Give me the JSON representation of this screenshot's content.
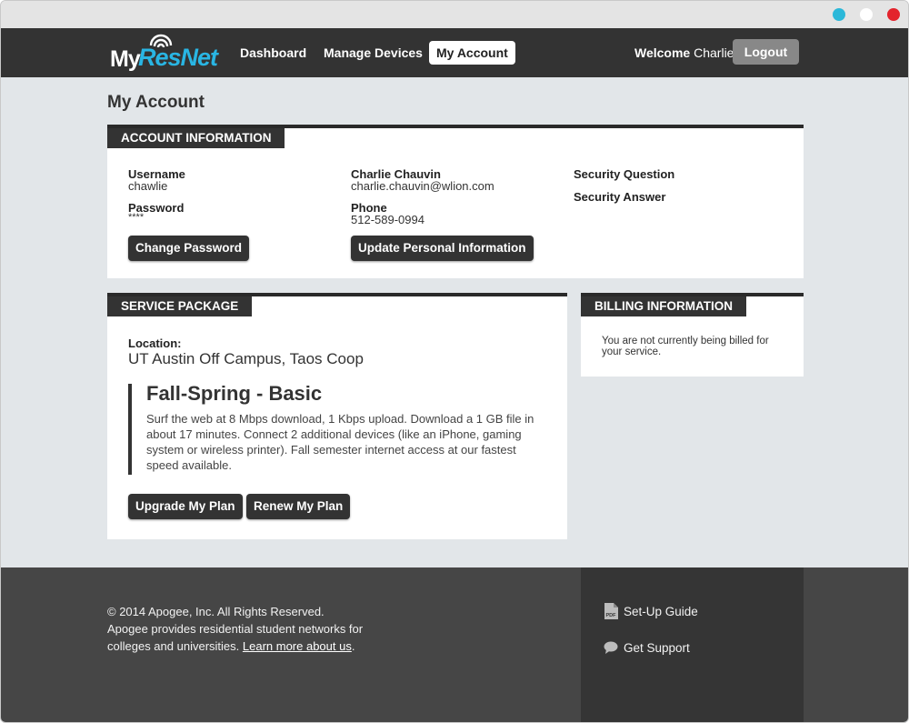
{
  "window": {
    "controls": [
      "blue-dot",
      "white-dot",
      "red-dot"
    ],
    "colors": {
      "blue": "#2bb8d9",
      "white": "#ffffff",
      "red": "#e3232c"
    }
  },
  "header": {
    "logo_my": "My",
    "logo_resnet": "ResNet",
    "nav": [
      {
        "label": "Dashboard",
        "active": false
      },
      {
        "label": "Manage Devices",
        "active": false
      },
      {
        "label": "My Account",
        "active": true
      }
    ],
    "welcome_prefix": "Welcome",
    "user_name": "Charlie",
    "logout_label": "Logout"
  },
  "page_title": "My Account",
  "account_info": {
    "tab": "ACCOUNT INFORMATION",
    "username_label": "Username",
    "username_value": "chawlie",
    "password_label": "Password",
    "password_value": "****",
    "change_password_button": "Change Password",
    "full_name": "Charlie Chauvin",
    "email": "charlie.chauvin@wlion.com",
    "phone_label": "Phone",
    "phone_value": "512-589-0994",
    "update_button": "Update Personal Information",
    "security_question_label": "Security Question",
    "security_answer_label": "Security Answer"
  },
  "service_package": {
    "tab": "SERVICE PACKAGE",
    "location_label": "Location:",
    "location_value": "UT Austin Off Campus, Taos Coop",
    "plan_name": "Fall-Spring - Basic",
    "plan_description": "Surf the web at 8 Mbps download, 1 Kbps upload. Download a 1 GB file in about 17 minutes. Connect 2 additional devices (like an iPhone, gaming system or wireless printer). Fall semester internet access at our fastest speed available.",
    "upgrade_button": "Upgrade My Plan",
    "renew_button": "Renew My Plan"
  },
  "billing": {
    "tab": "BILLING INFORMATION",
    "message": "You are not currently being billed for your service."
  },
  "footer": {
    "copyright": "© 2014 Apogee, Inc. All Rights Reserved.",
    "about_line1": "Apogee provides residential student networks for",
    "about_line2_prefix": "colleges and universities.",
    "learn_more": "Learn more about us",
    "about_suffix": ".",
    "setup_guide": "Set-Up Guide",
    "get_support": "Get Support",
    "pdf_icon_text": "PDF"
  }
}
